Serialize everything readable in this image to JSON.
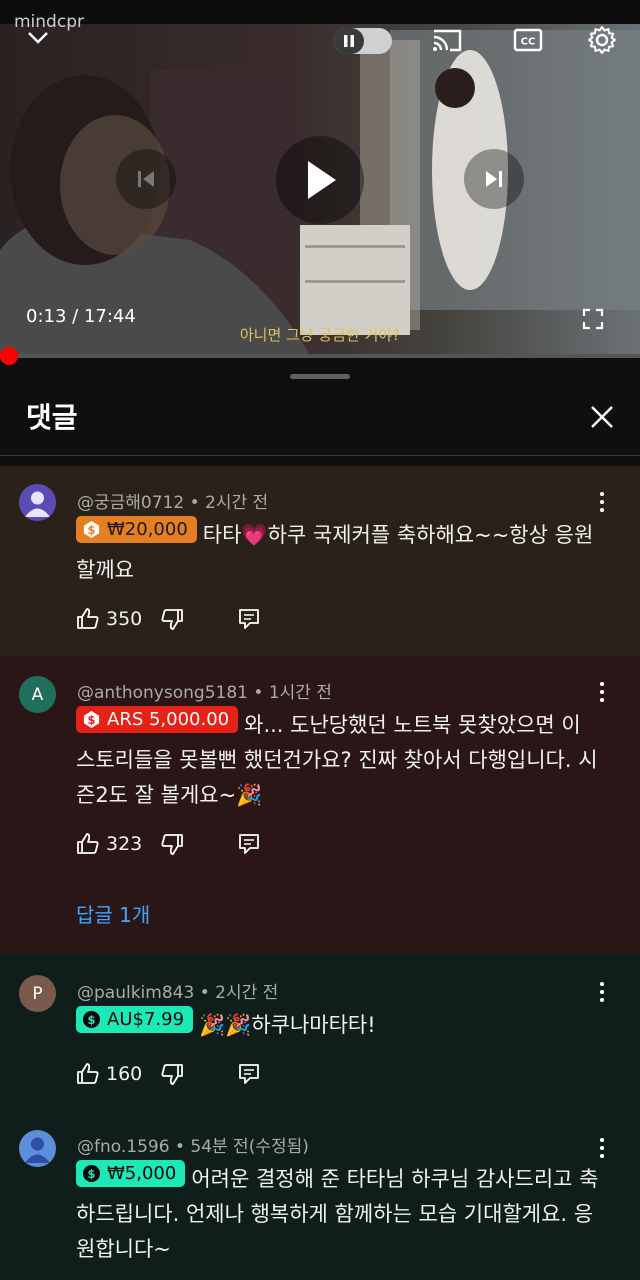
{
  "video": {
    "watermark": "mindcpr",
    "current_time": "0:13",
    "time_separator": " / ",
    "duration": "17:44",
    "subtitle": "아니면 그냥 궁금한 거야?",
    "progress_fraction": 0.012
  },
  "panel": {
    "title": "댓글"
  },
  "comments": [
    {
      "avatar_letter": "",
      "avatar_color": "#5b4bb5",
      "handle": "@궁금해0712",
      "time": "2시간 전",
      "chip_amount": "₩20,000",
      "chip_color": "#e67e22",
      "chip_text_color": "#1a1a1a",
      "text": "타타💗하쿠 국제커플 축하해요~~항상 응원할께요",
      "likes": "350",
      "bg": "#2a2118"
    },
    {
      "avatar_letter": "A",
      "avatar_color": "#1f6f5c",
      "handle": "@anthonysong5181",
      "time": "1시간 전",
      "chip_amount": "ARS 5,000.00",
      "chip_color": "#e62117",
      "chip_text_color": "#ffffff",
      "text": "와... 도난당했던 노트북 못찾았으면 이 스토리들을 못볼뻔 했던건가요? 진짜 찾아서 다행입니다. 시즌2도 잘 볼게요~🎉",
      "likes": "323",
      "replies": "답글 1개",
      "bg": "#2a1616"
    },
    {
      "avatar_letter": "P",
      "avatar_color": "#7a5a4c",
      "handle": "@paulkim843",
      "time": "2시간 전",
      "chip_amount": "AU$7.99",
      "chip_color": "#1de9b6",
      "chip_text_color": "#0a0a0a",
      "text": "🎉🎉하쿠나마타타!",
      "likes": "160",
      "bg": "#0f1e1b"
    },
    {
      "avatar_letter": "",
      "avatar_color": "#5b8fd9",
      "handle": "@fno.1596",
      "time": "54분 전(수정됨)",
      "chip_amount": "₩5,000",
      "chip_color": "#1de9b6",
      "chip_text_color": "#0a0a0a",
      "text": "어려운 결정해 준 타타님 하쿠님 감사드리고 축하드립니다. 언제나 행복하게 함께하는 모습 기대할게요. 응원합니다~",
      "likes": "",
      "bg": "#0f1e1b"
    }
  ]
}
